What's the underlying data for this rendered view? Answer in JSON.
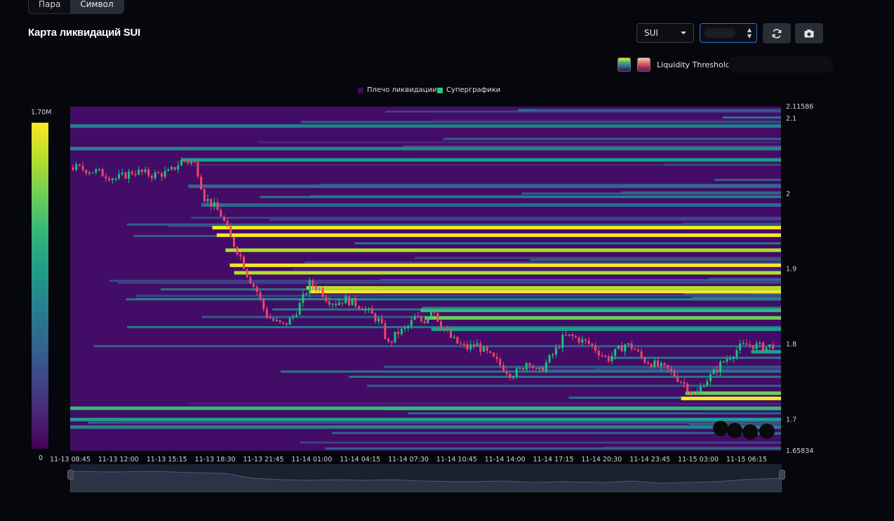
{
  "tabs": [
    {
      "label": "Пара",
      "active": false
    },
    {
      "label": "Символ",
      "active": true
    }
  ],
  "title": "Карта ликвидаций SUI",
  "symbol_select": {
    "value": "SUI"
  },
  "icons": {
    "refresh": "refresh-icon",
    "camera": "camera-icon"
  },
  "threshold_label": "Liquidity Threshold :",
  "legend": {
    "items": [
      {
        "label": "Плечо ликвидации",
        "color": "#3d0a5c"
      },
      {
        "label": "Суперграфики",
        "color": "#2ec983"
      }
    ]
  },
  "colorbar": {
    "max_label": "1.70M",
    "min_label": "0"
  },
  "colors": {
    "background": "#05070c",
    "heatmap_base": "#430c66",
    "candle_up": "#19c37d",
    "candle_down": "#f0446b",
    "accent": "#2f6fe0"
  },
  "chart_data": {
    "type": "heatmap",
    "x_tick_labels": [
      "11-13 08:45",
      "11-13 12:00",
      "11-13 15:15",
      "11-13 18:30",
      "11-13 21:45",
      "11-14 01:00",
      "11-14 04:15",
      "11-14 07:30",
      "11-14 10:45",
      "11-14 14:00",
      "11-14 17:15",
      "11-14 20:30",
      "11-14 23:45",
      "11-15 03:00",
      "11-15 06:15"
    ],
    "y_tick_labels": [
      "2.11586",
      "2.1",
      "2",
      "1.9",
      "1.8",
      "1.7",
      "1.65834"
    ],
    "y_ticks": [
      2.11586,
      2.1,
      2.0,
      1.9,
      1.8,
      1.7,
      1.65834
    ],
    "ylim": [
      1.65834,
      2.11586
    ],
    "price_path": [
      [
        0,
        2.035
      ],
      [
        5,
        2.03
      ],
      [
        10,
        2.02
      ],
      [
        14,
        2.03
      ],
      [
        18,
        2.025
      ],
      [
        22,
        2.028
      ],
      [
        25,
        2.045
      ],
      [
        28,
        2.04
      ],
      [
        30,
        1.995
      ],
      [
        32,
        1.985
      ],
      [
        34,
        1.97
      ],
      [
        36,
        1.94
      ],
      [
        38,
        1.92
      ],
      [
        40,
        1.89
      ],
      [
        42,
        1.87
      ],
      [
        44,
        1.84
      ],
      [
        46,
        1.83
      ],
      [
        48,
        1.825
      ],
      [
        50,
        1.835
      ],
      [
        52,
        1.855
      ],
      [
        54,
        1.88
      ],
      [
        56,
        1.875
      ],
      [
        58,
        1.86
      ],
      [
        60,
        1.855
      ],
      [
        62,
        1.86
      ],
      [
        64,
        1.855
      ],
      [
        66,
        1.85
      ],
      [
        68,
        1.84
      ],
      [
        70,
        1.83
      ],
      [
        72,
        1.8
      ],
      [
        74,
        1.815
      ],
      [
        76,
        1.82
      ],
      [
        78,
        1.835
      ],
      [
        80,
        1.83
      ],
      [
        82,
        1.85
      ],
      [
        84,
        1.825
      ],
      [
        86,
        1.81
      ],
      [
        88,
        1.8
      ],
      [
        90,
        1.795
      ],
      [
        92,
        1.8
      ],
      [
        94,
        1.79
      ],
      [
        96,
        1.78
      ],
      [
        98,
        1.77
      ],
      [
        100,
        1.76
      ],
      [
        102,
        1.765
      ],
      [
        104,
        1.78
      ],
      [
        106,
        1.76
      ],
      [
        108,
        1.775
      ],
      [
        110,
        1.79
      ],
      [
        112,
        1.81
      ],
      [
        114,
        1.81
      ],
      [
        116,
        1.805
      ],
      [
        118,
        1.8
      ],
      [
        120,
        1.79
      ],
      [
        122,
        1.78
      ],
      [
        124,
        1.79
      ],
      [
        126,
        1.8
      ],
      [
        128,
        1.795
      ],
      [
        130,
        1.78
      ],
      [
        132,
        1.775
      ],
      [
        134,
        1.77
      ],
      [
        136,
        1.765
      ],
      [
        138,
        1.755
      ],
      [
        140,
        1.745
      ],
      [
        142,
        1.73
      ],
      [
        144,
        1.75
      ],
      [
        146,
        1.76
      ],
      [
        148,
        1.775
      ],
      [
        150,
        1.785
      ],
      [
        152,
        1.795
      ],
      [
        154,
        1.8
      ],
      [
        156,
        1.798
      ],
      [
        158,
        1.795
      ],
      [
        160,
        1.8
      ]
    ],
    "liquidation_levels": [
      {
        "price": 1.955,
        "intensity": 1.0
      },
      {
        "price": 1.945,
        "intensity": 0.95
      },
      {
        "price": 1.925,
        "intensity": 0.85
      },
      {
        "price": 1.905,
        "intensity": 0.95
      },
      {
        "price": 1.895,
        "intensity": 0.9
      },
      {
        "price": 1.87,
        "intensity": 1.0
      },
      {
        "price": 1.875,
        "intensity": 0.85
      },
      {
        "price": 1.845,
        "intensity": 0.7
      },
      {
        "price": 1.835,
        "intensity": 0.75
      },
      {
        "price": 1.82,
        "intensity": 0.6
      },
      {
        "price": 1.79,
        "intensity": 0.5
      },
      {
        "price": 1.735,
        "intensity": 0.75
      },
      {
        "price": 1.728,
        "intensity": 0.95
      },
      {
        "price": 1.715,
        "intensity": 0.7
      },
      {
        "price": 1.7,
        "intensity": 0.55
      },
      {
        "price": 1.69,
        "intensity": 0.45
      },
      {
        "price": 2.045,
        "intensity": 0.5
      },
      {
        "price": 2.06,
        "intensity": 0.45
      },
      {
        "price": 2.09,
        "intensity": 0.45
      },
      {
        "price": 2.01,
        "intensity": 0.3
      },
      {
        "price": 1.985,
        "intensity": 0.35
      }
    ]
  }
}
